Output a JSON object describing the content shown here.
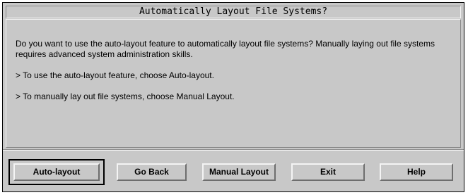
{
  "dialog": {
    "title": "Automatically Layout File Systems?",
    "paragraphs": [
      "Do you want to use the auto-layout feature to automatically layout file systems? Manually laying out file systems requires advanced system administration skills.",
      "> To use the auto-layout feature, choose Auto-layout.",
      "> To manually lay out file systems, choose Manual Layout."
    ]
  },
  "buttons": {
    "auto_layout": "Auto-layout",
    "go_back": "Go Back",
    "manual_layout": "Manual Layout",
    "exit": "Exit",
    "help": "Help"
  },
  "colors": {
    "background": "#c8c8c8",
    "highlight": "#f2f2f2",
    "shadow": "#8a8a8a",
    "text": "#000000"
  }
}
